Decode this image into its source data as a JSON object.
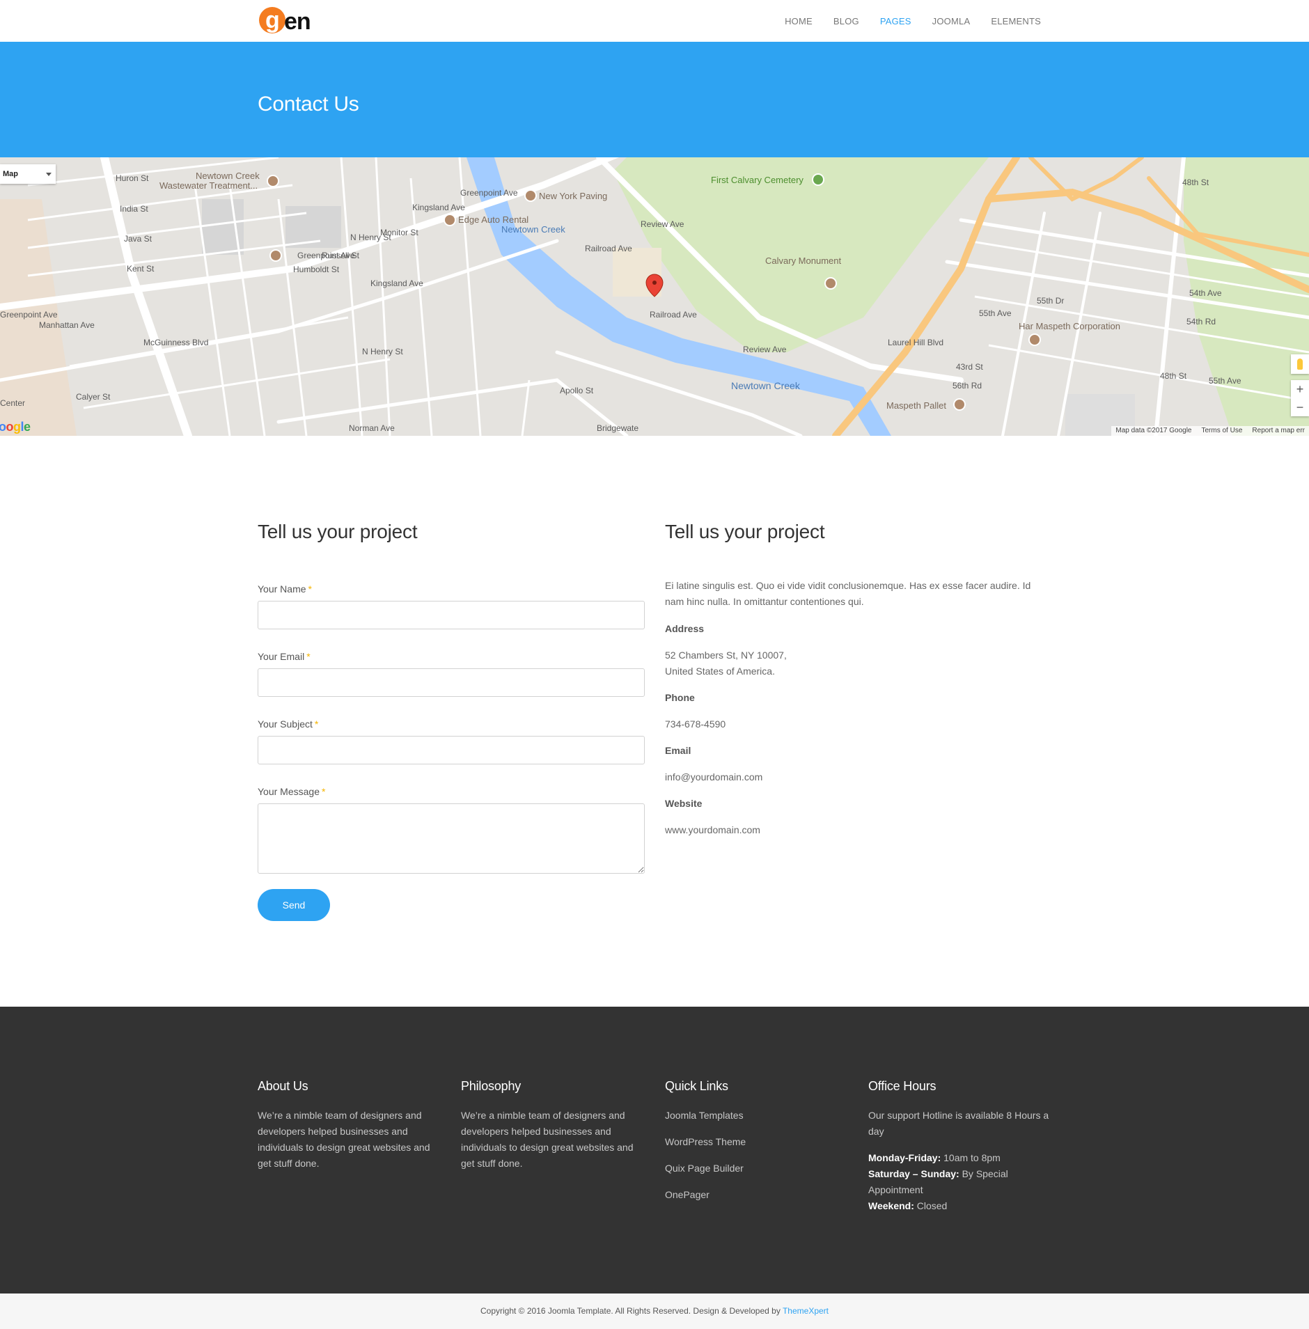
{
  "header": {
    "logo_letter": "g",
    "logo_rest": "en",
    "nav": [
      "HOME",
      "BLOG",
      "PAGES",
      "JOOMLA",
      "ELEMENTS"
    ],
    "active_nav": "PAGES"
  },
  "banner": {
    "title": "Contact Us"
  },
  "map": {
    "type_label": "Map",
    "attribution": [
      "Map data ©2017 Google",
      "Terms of Use",
      "Report a map err"
    ],
    "google_logo": "oogle",
    "labels": {
      "newtown_creek_plant": "Newtown Creek",
      "wastewater": "Wastewater Treatment...",
      "new_york_paving": "New York Paving",
      "edge_auto_rental": "Edge Auto Rental",
      "first_calvary": "First Calvary Cemetery",
      "calvary_monument": "Calvary Monument",
      "har_maspeth": "Har Maspeth Corporation",
      "maspeth_pallet": "Maspeth Pallet",
      "newtown_creek_water": "Newtown Creek",
      "review_ave": "Review Ave",
      "railroad_ave": "Railroad Ave",
      "laurel_hill": "Laurel Hill Blvd",
      "greenpoint_ave": "Greenpoint Ave",
      "norman_ave": "Norman Ave",
      "bridgewater": "Bridgewate",
      "huron_st": "Huron St",
      "india_st": "India St",
      "java_st": "Java St",
      "kent_st": "Kent St",
      "center": "Center",
      "calyer_st": "Calyer St",
      "kingsland_ave": "Kingsland Ave",
      "monitor_st": "Monitor St",
      "n_henry_st": "N Henry St",
      "russell_st": "Russell St",
      "humboldt_st": "Humboldt St",
      "mcguinness": "McGuinness Blvd",
      "manhattan_ave": "Manhattan Ave",
      "apollo_st": "Apollo St",
      "st_55th_ave": "55th Ave",
      "st_54th_ave": "54th Ave",
      "st_54th_rd": "54th Rd",
      "st_55th_dr": "55th Dr",
      "st_48th_st": "48th St",
      "st_43rd_st": "43rd St",
      "st_56th_rd": "56th Rd"
    }
  },
  "form": {
    "title": "Tell us your project",
    "name_label": "Your Name",
    "email_label": "Your Email",
    "subject_label": "Your Subject",
    "message_label": "Your Message",
    "required_mark": "*",
    "send_label": "Send"
  },
  "info": {
    "title": "Tell us your project",
    "intro_line1": "Ei latine singulis est. Quo ei vide vidit conclusionemque. Has ex esse facer audire. Id",
    "intro_line2": "nam hinc nulla. In omittantur contentiones qui.",
    "address_label": "Address",
    "address_line1": "52 Chambers St, NY 10007,",
    "address_line2": "United States of America.",
    "phone_label": "Phone",
    "phone": "734-678-4590",
    "email_label": "Email",
    "email": "info@yourdomain.com",
    "website_label": "Website",
    "website": "www.yourdomain.com"
  },
  "footer": {
    "about": {
      "title": "About Us",
      "text": "We’re a nimble team of designers and developers helped businesses and individuals to design great websites and get stuff done."
    },
    "philosophy": {
      "title": "Philosophy",
      "text": "We’re a nimble team of designers and developers helped businesses and individuals to design great websites and get stuff done."
    },
    "quick_links": {
      "title": "Quick Links",
      "links": [
        "Joomla Templates",
        "WordPress Theme",
        "Quix Page Builder",
        "OnePager"
      ]
    },
    "office_hours": {
      "title": "Office Hours",
      "text": "Our support Hotline is available 8 Hours a day",
      "weekday_label": "Monday-Friday:",
      "weekday_value": "10am to 8pm",
      "saturday_label": "Saturday – Sunday:",
      "saturday_value": "By Special Appointment",
      "weekend_label": "Weekend:",
      "weekend_value": "Closed"
    }
  },
  "copyright": {
    "text": "Copyright © 2016 Joomla Template. All Rights Reserved. Design & Developed by",
    "link": "ThemeXpert"
  },
  "colors": {
    "accent": "#2ea3f2",
    "logo_orange": "#f47c20",
    "footer_bg": "#333333",
    "required": "#f5b400"
  }
}
